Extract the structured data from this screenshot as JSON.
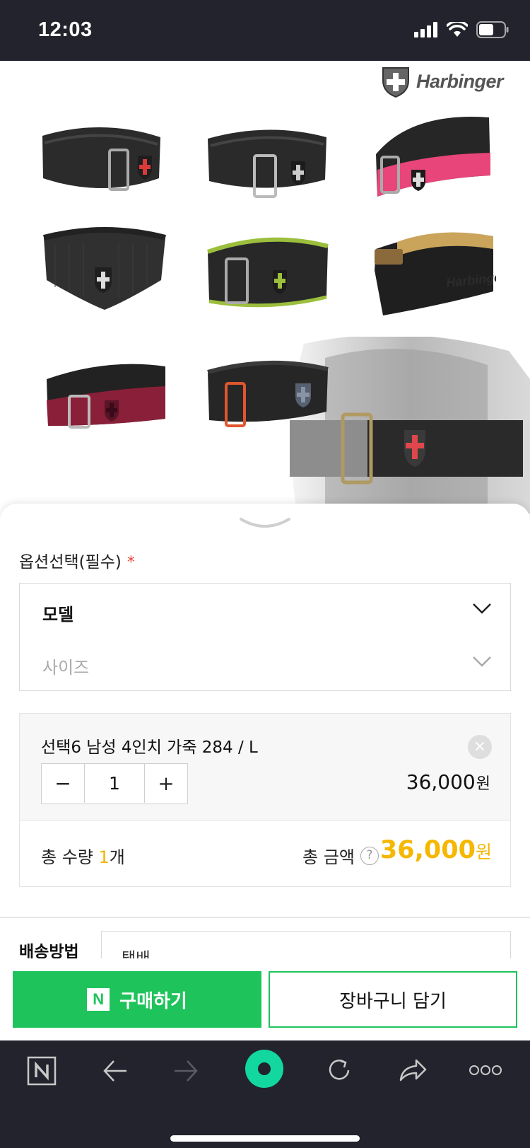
{
  "status_bar": {
    "time": "12:03",
    "icons": [
      "signal-icon",
      "wifi-icon",
      "battery-icon"
    ]
  },
  "product": {
    "brand": "Harbinger",
    "belts": [
      {
        "name": "black-belt-red-cross",
        "color": "#2b2b2b",
        "accent": "#d93a3a"
      },
      {
        "name": "black-belt-grey-cross",
        "color": "#2a2a2a",
        "accent": "#cccccc"
      },
      {
        "name": "pink-belt",
        "color": "#262626",
        "accent": "#e8457a"
      },
      {
        "name": "mesh-black-belt",
        "color": "#303030",
        "accent": "#dddddd"
      },
      {
        "name": "green-trim-belt",
        "color": "#282828",
        "accent": "#9bbf3c"
      },
      {
        "name": "leather-belt",
        "color": "#1f1f1f",
        "accent": "#c9a45a"
      },
      {
        "name": "maroon-belt",
        "color": "#222222",
        "accent": "#8a1f3a"
      },
      {
        "name": "orange-buckle-belt",
        "color": "#262626",
        "accent": "#e0562e"
      }
    ]
  },
  "options": {
    "title": "옵션선택(필수)",
    "required_mark": "*",
    "model_label": "모델",
    "size_label": "사이즈"
  },
  "selected_item": {
    "name": "선택6 남성 4인치 가죽 284 / L",
    "quantity": "1",
    "minus": "−",
    "plus": "+",
    "price": "36,000",
    "currency": "원"
  },
  "totals": {
    "qty_prefix": "총 수량 ",
    "qty_value": "1",
    "qty_suffix": "개",
    "amount_label": "총 금액",
    "help": "?",
    "amount": "36,000",
    "currency": "원"
  },
  "shipping": {
    "label": "배송방법",
    "value": "택배"
  },
  "actions": {
    "buy_badge": "N",
    "buy_label": "구매하기",
    "cart_label": "장바구니 담기"
  },
  "toolbar": {
    "items": [
      "naver-home-icon",
      "back-icon",
      "forward-icon",
      "green-dot-icon",
      "reload-icon",
      "share-icon",
      "more-icon"
    ]
  },
  "colors": {
    "brand_green": "#1ec35b",
    "price_yellow": "#f5b700",
    "dark_bar": "#23232d"
  }
}
